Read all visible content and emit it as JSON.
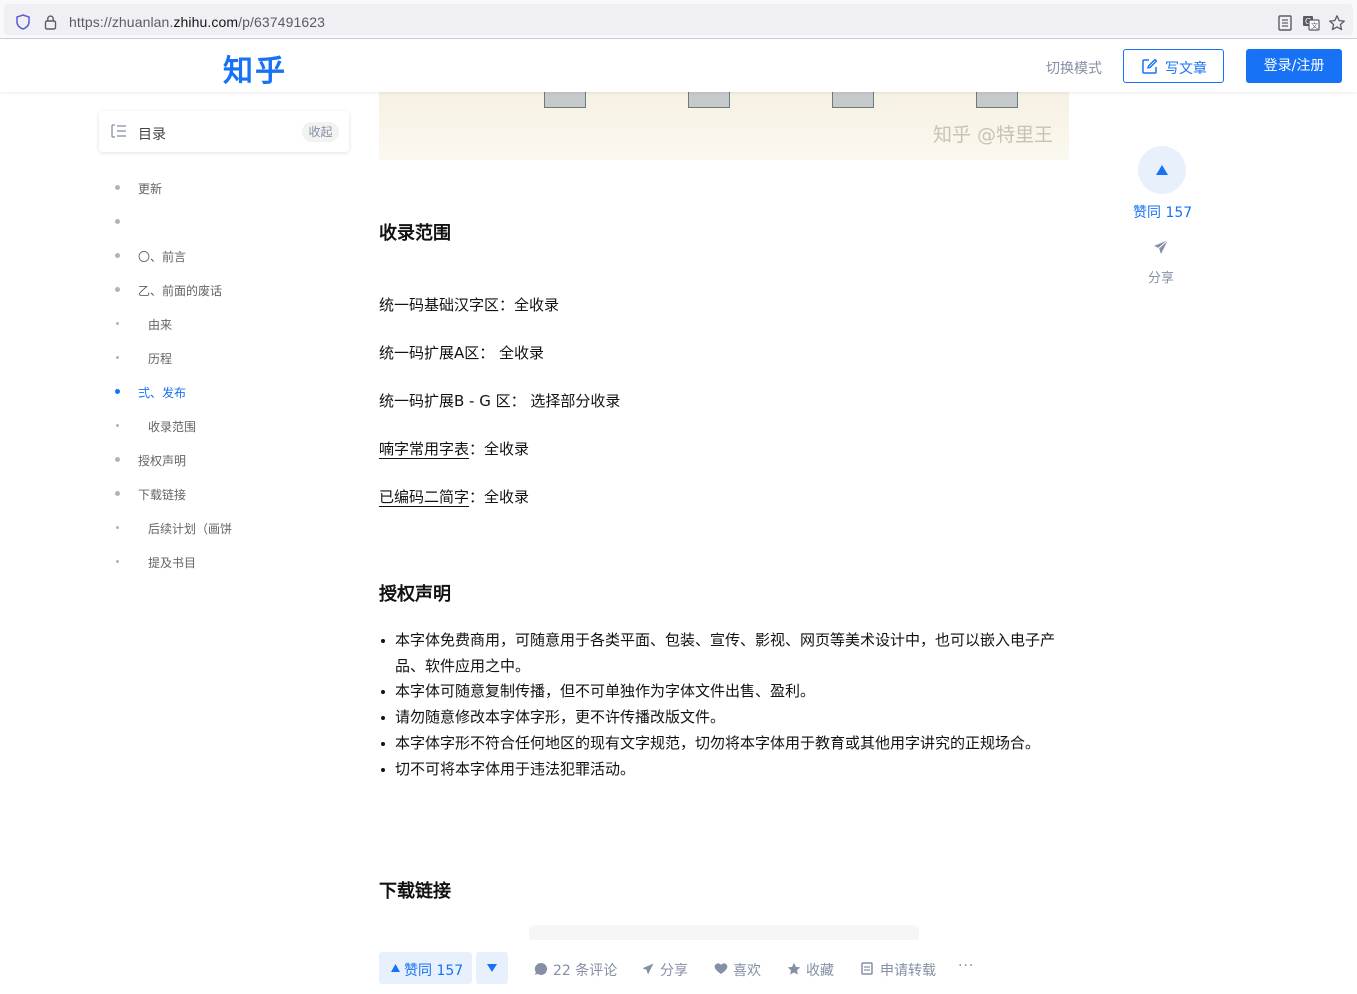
{
  "browser": {
    "url_prefix": "https://zhuanlan.",
    "url_domain": "zhihu.com",
    "url_path": "/p/637491623"
  },
  "header": {
    "logo": "知乎",
    "switch_mode": "切换模式",
    "write_label": "写文章",
    "login_label": "登录/注册"
  },
  "hero": {
    "watermark": "知乎 @特里王"
  },
  "toc": {
    "title": "目录",
    "collapse_label": "收起",
    "items": [
      {
        "label": "更新",
        "active": false
      },
      {
        "label": "",
        "active": false
      },
      {
        "label": "〇、前言",
        "active": false
      },
      {
        "label": "乙、前面的废话",
        "active": false
      },
      {
        "label": "由来",
        "active": false
      },
      {
        "label": "历程",
        "active": false
      },
      {
        "label": "弍、发布",
        "active": true
      },
      {
        "label": "收录范围",
        "active": false
      },
      {
        "label": "授权声明",
        "active": false
      },
      {
        "label": "下载链接",
        "active": false
      },
      {
        "label": "后续计划（画饼",
        "active": false
      },
      {
        "label": "提及书目",
        "active": false
      }
    ]
  },
  "side": {
    "vote_label": "赞同 157",
    "share_label": "分享"
  },
  "article": {
    "h_scope": "收录范围",
    "scope": [
      {
        "key": "统一码基础汉字区",
        "value": "：全收录"
      },
      {
        "key": "统一码扩展A区",
        "value": "：  全收录"
      },
      {
        "key": "统一码扩展B - G 区",
        "value": "：  选择部分收录"
      },
      {
        "key": "喃字常用字表",
        "value": "：全收录"
      },
      {
        "key": "已编码二简字",
        "value": "：全收录"
      }
    ],
    "h_license": "授权声明",
    "license": [
      "本字体免费商用，可随意用于各类平面、包装、宣传、影视、网页等美术设计中，也可以嵌入电子产品、软件应用之中。",
      "本字体可随意复制传播，但不可单独作为字体文件出售、盈利。",
      "请勿随意修改本字体字形，更不许传播改版文件。",
      "本字体字形不符合任何地区的现有文字规范，切勿将本字体用于教育或其他用字讲究的正规场合。",
      "切不可将本字体用于违法犯罪活动。"
    ],
    "h_download": "下载链接"
  },
  "actions": {
    "vote_label": "赞同 157",
    "comments": "22 条评论",
    "share": "分享",
    "like": "喜欢",
    "favorite": "收藏",
    "repost": "申请转载",
    "more": "···"
  },
  "colors": {
    "accent": "#1772f6",
    "muted": "#8590a6"
  }
}
